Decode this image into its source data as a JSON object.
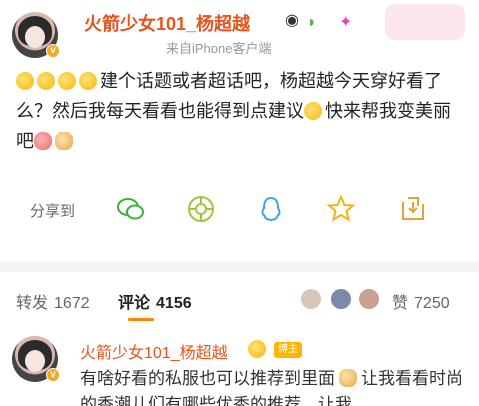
{
  "post": {
    "username": "火箭少女101_杨超越",
    "source": "来自iPhone客户端",
    "verified_mark": "v",
    "content_text_1": "建个话题或者超话吧，杨超越今天穿好看了么？然后我每天看看也能得到点建议",
    "content_text_2": "快来帮我变美丽吧",
    "accent_color": "#e8541e"
  },
  "share_bar": {
    "label": "分享到",
    "targets": [
      "wechat-icon",
      "moments-icon",
      "qq-icon",
      "qzone-icon",
      "save-icon"
    ]
  },
  "tabs": {
    "repost_label": "转发",
    "repost_count": "1672",
    "comment_label": "评论",
    "comment_count": "4156",
    "like_label": "赞",
    "like_count": "7250",
    "active_color": "#ff8200"
  },
  "comment": {
    "username": "火箭少女101_杨超越",
    "author_badge": "博主",
    "verified_mark": "v",
    "text": "有啥好看的私服也可以推荐到里面",
    "text_2": "让我看看时尚的香潮儿们有哪些优秀的推荐，让我"
  }
}
